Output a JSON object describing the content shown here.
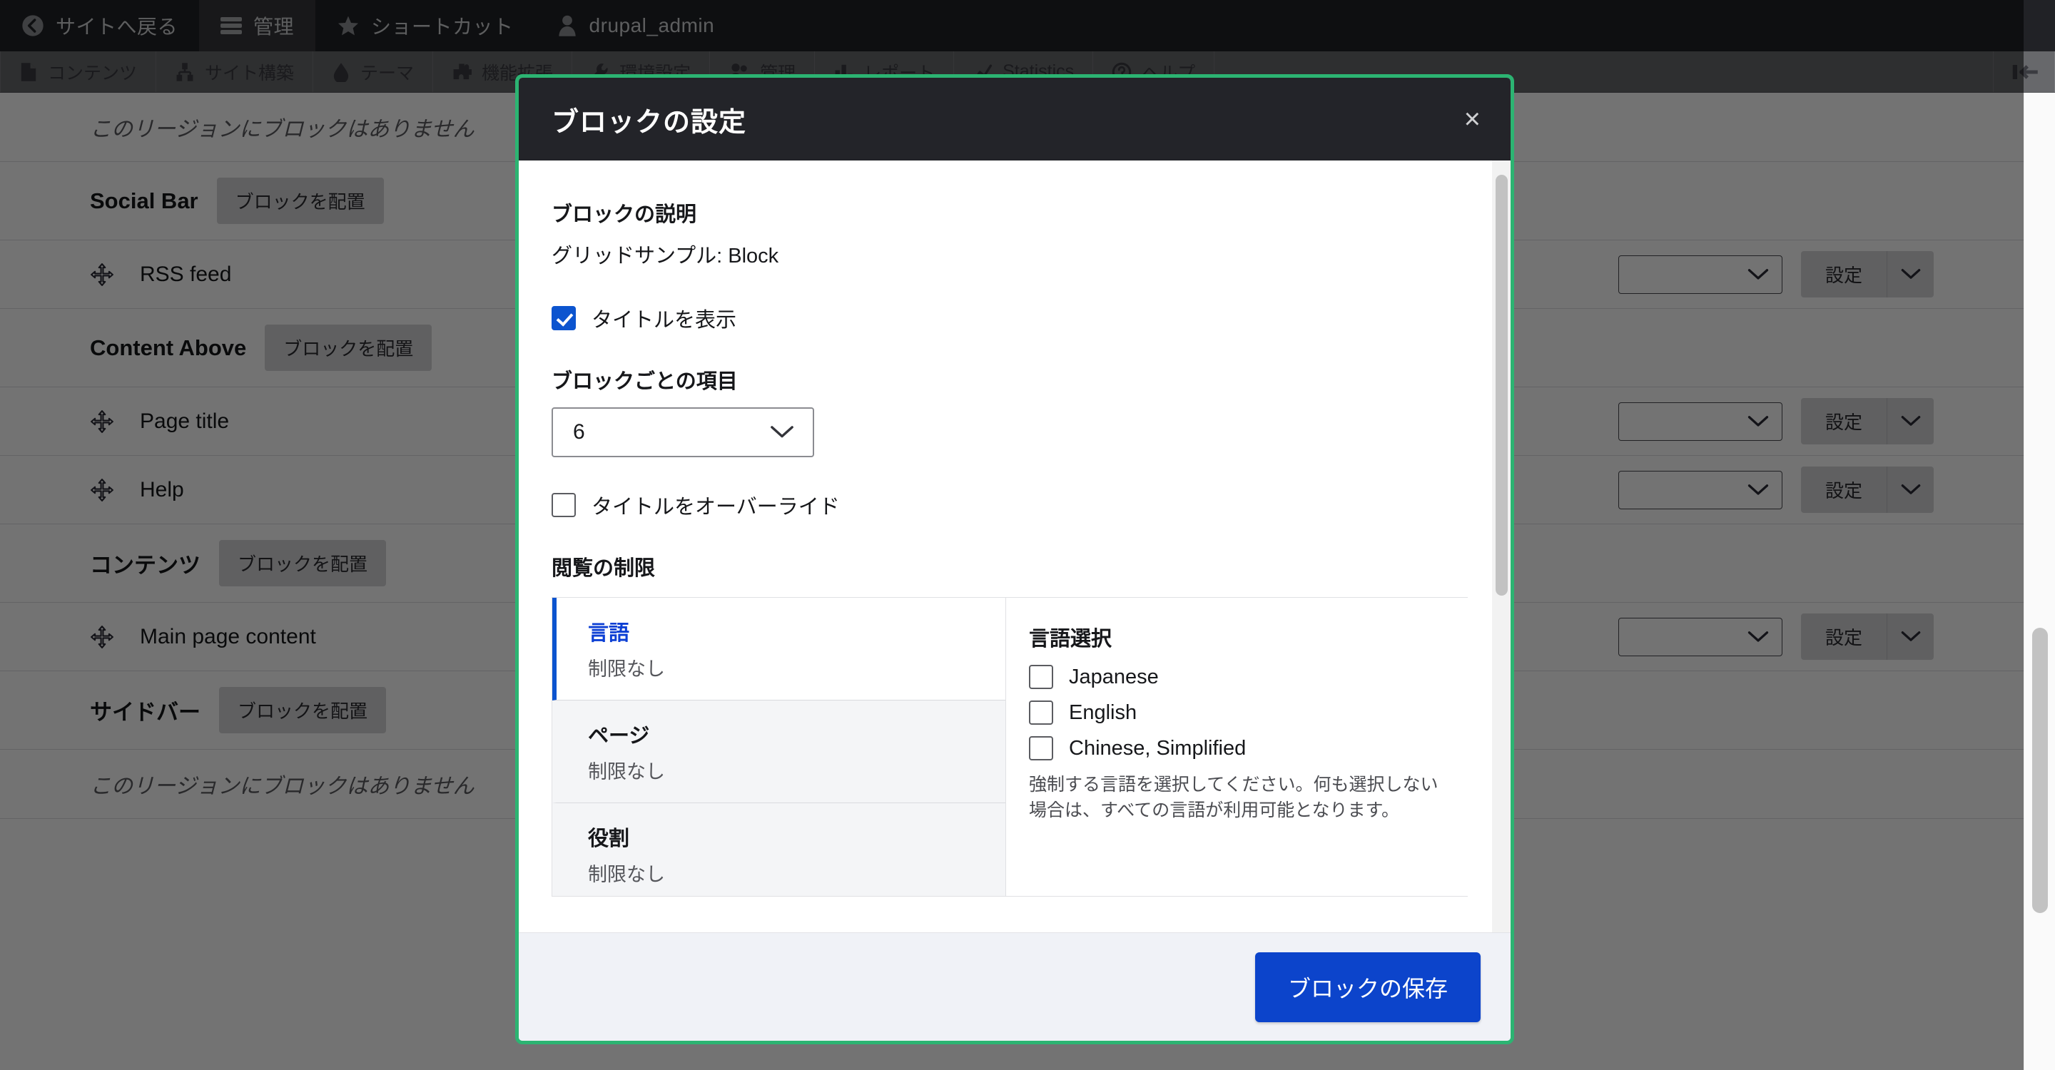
{
  "toolbar": {
    "top_items": [
      {
        "label": "サイトへ戻る",
        "icon": "back-circle-icon",
        "active": false
      },
      {
        "label": "管理",
        "icon": "hamburger-icon",
        "active": true
      },
      {
        "label": "ショートカット",
        "icon": "star-icon",
        "active": false
      },
      {
        "label": "drupal_admin",
        "icon": "user-icon",
        "active": false
      }
    ],
    "sub_items": [
      {
        "label": "コンテンツ",
        "icon": "content-icon"
      },
      {
        "label": "サイト構築",
        "icon": "structure-icon"
      },
      {
        "label": "テーマ",
        "icon": "theme-icon"
      },
      {
        "label": "機能拡張",
        "icon": "puzzle-icon"
      },
      {
        "label": "環境設定",
        "icon": "wrench-icon"
      },
      {
        "label": "管理",
        "icon": "people-icon"
      },
      {
        "label": "レポート",
        "icon": "report-icon"
      },
      {
        "label": "Statistics",
        "icon": "chart-icon"
      },
      {
        "label": "ヘルプ",
        "icon": "help-icon"
      }
    ],
    "collapse_icon": "collapse-toolbar-icon"
  },
  "page": {
    "empty_region_text": "このリージョンにブロックはありません",
    "place_block_label": "ブロックを配置",
    "configure_label": "設定",
    "rows": [
      {
        "type": "empty"
      },
      {
        "type": "region",
        "title": "Social Bar"
      },
      {
        "type": "block",
        "label": "RSS feed"
      },
      {
        "type": "region",
        "title": "Content Above"
      },
      {
        "type": "block",
        "label": "Page title"
      },
      {
        "type": "block",
        "label": "Help"
      },
      {
        "type": "region",
        "title": "コンテンツ"
      },
      {
        "type": "block",
        "label": "Main page content"
      },
      {
        "type": "region",
        "title": "サイドバー"
      },
      {
        "type": "empty"
      }
    ]
  },
  "modal": {
    "title": "ブロックの設定",
    "close_label": "×",
    "description_label": "ブロックの説明",
    "description_value": "グリッドサンプル: Block",
    "show_title": {
      "label": "タイトルを表示",
      "checked": true
    },
    "items_per_block": {
      "label": "ブロックごとの項目",
      "value": "6"
    },
    "override_title": {
      "label": "タイトルをオーバーライド",
      "checked": false
    },
    "visibility_label": "閲覧の制限",
    "tabs": [
      {
        "title": "言語",
        "summary": "制限なし",
        "active": true
      },
      {
        "title": "ページ",
        "summary": "制限なし",
        "active": false
      },
      {
        "title": "役割",
        "summary": "制限なし",
        "active": false
      }
    ],
    "pane": {
      "title": "言語選択",
      "options": [
        {
          "label": "Japanese",
          "checked": false
        },
        {
          "label": "English",
          "checked": false
        },
        {
          "label": "Chinese, Simplified",
          "checked": false
        }
      ],
      "description": "強制する言語を選択してください。何も選択しない場合は、すべての言語が利用可能となります。"
    },
    "save_label": "ブロックの保存"
  },
  "colors": {
    "modal_border": "#2cb472",
    "header_bg": "#232429",
    "primary": "#0c44cb",
    "tab_active": "#0c3fd4",
    "checkbox_checked": "#0c54cf"
  }
}
